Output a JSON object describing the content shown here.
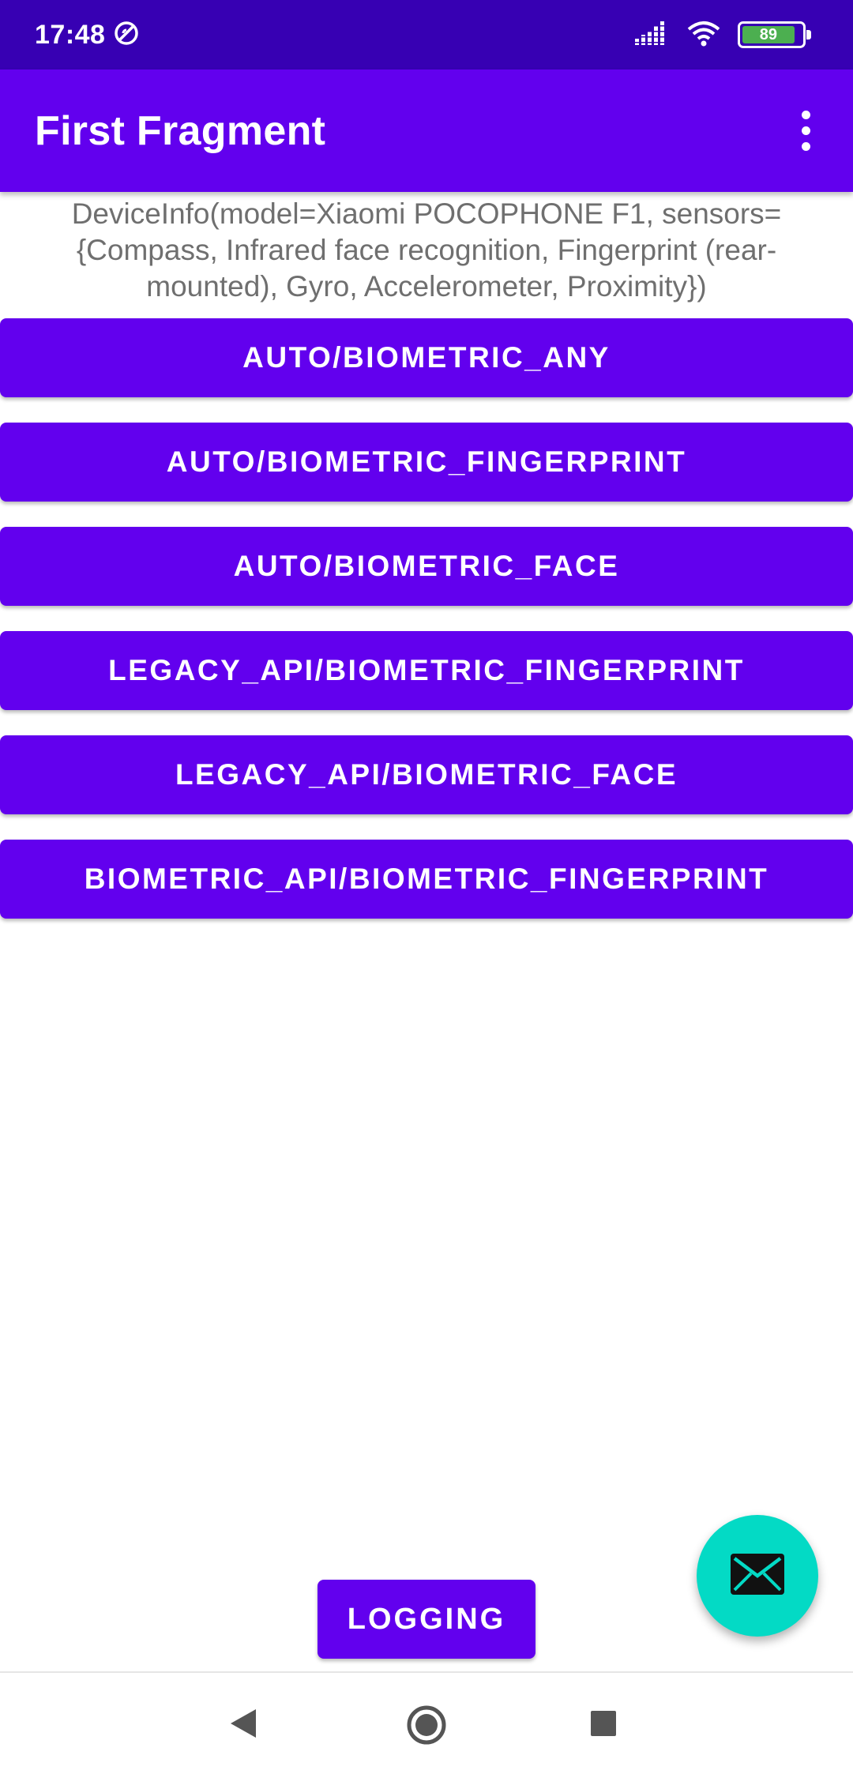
{
  "status_bar": {
    "time": "17:48",
    "battery_level": "89",
    "icons": [
      "data-saver-icon",
      "signal-icon",
      "wifi-icon",
      "battery-icon"
    ]
  },
  "app_bar": {
    "title": "First Fragment",
    "overflow_icon": "more-vert-icon"
  },
  "device_info": {
    "text": "DeviceInfo(model=Xiaomi POCOPHONE F1, sensors={Compass, Infrared face recognition, Fingerprint (rear-mounted), Gyro, Accelerometer, Proximity})"
  },
  "buttons": [
    {
      "label": "AUTO/BIOMETRIC_ANY"
    },
    {
      "label": "AUTO/BIOMETRIC_FINGERPRINT"
    },
    {
      "label": "AUTO/BIOMETRIC_FACE"
    },
    {
      "label": "LEGACY_API/BIOMETRIC_FINGERPRINT"
    },
    {
      "label": "LEGACY_API/BIOMETRIC_FACE"
    },
    {
      "label": "BIOMETRIC_API/BIOMETRIC_FINGERPRINT"
    }
  ],
  "logging_button": {
    "label": "LOGGING"
  },
  "fab": {
    "icon": "mail-icon"
  },
  "nav_bar": {
    "icons": [
      "back-icon",
      "home-icon",
      "recents-icon"
    ]
  },
  "colors": {
    "status_bar": "#3700B3",
    "primary": "#6200EE",
    "fab": "#03DAC5",
    "body_text": "#6f6f6f"
  }
}
